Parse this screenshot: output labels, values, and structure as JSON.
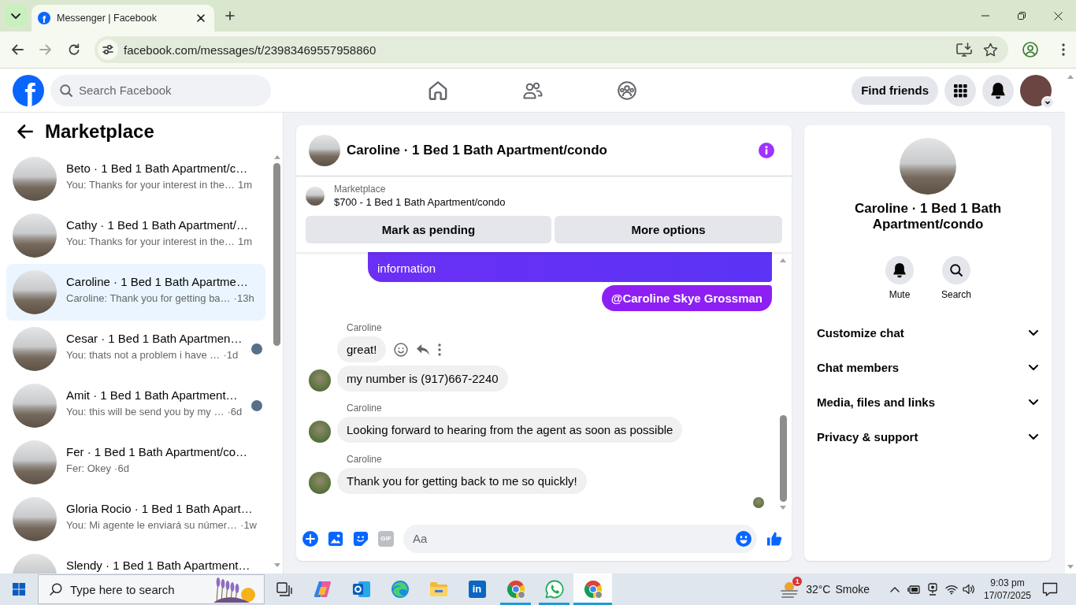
{
  "browser": {
    "tabs": [
      {
        "favicon": "f",
        "title": "Messenger | Facebook",
        "selected": true
      }
    ],
    "forward": {
      "disabled": true
    },
    "url": "facebook.com/messages/t/23983469557958860"
  },
  "header": {
    "logo": "f",
    "search": {
      "placeholder": "Search Facebook"
    },
    "find_friends": "Find friends"
  },
  "sidebar": {
    "title": "Marketplace",
    "conversations": [
      {
        "title": "Beto · 1 Bed 1 Bath Apartment/c…",
        "preview": "You: Thanks for your interest in the…",
        "time": "1m",
        "selected": false,
        "seen": false
      },
      {
        "title": "Cathy · 1 Bed 1 Bath Apartment/…",
        "preview": "You: Thanks for your interest in the…",
        "time": "1m",
        "selected": false,
        "seen": false
      },
      {
        "title": "Caroline · 1 Bed 1 Bath Apartme…",
        "preview": "Caroline: Thank you for getting ba…",
        "time": "·13h",
        "selected": true,
        "seen": false
      },
      {
        "title": "Cesar · 1 Bed 1 Bath Apartmen…",
        "preview": "You: thats not a problem i have …",
        "time": "·1d",
        "selected": false,
        "seen": true
      },
      {
        "title": "Amit · 1 Bed 1 Bath Apartment…",
        "preview": "You: this will be send you by my …",
        "time": "·6d",
        "selected": false,
        "seen": true
      },
      {
        "title": "Fer · 1 Bed 1 Bath Apartment/co…",
        "preview": "Fer: Okey",
        "time": "·6d",
        "selected": false,
        "seen": false
      },
      {
        "title": "Gloria Rocio · 1 Bed 1 Bath Apart…",
        "preview": "You: Mi agente le enviará su númer…",
        "time": "·1w",
        "selected": false,
        "seen": false
      },
      {
        "title": "Slendy · 1 Bed 1 Bath Apartment…",
        "selected": false,
        "seen": false
      }
    ]
  },
  "chat": {
    "title": "Caroline · 1 Bed 1 Bath Apartment/condo",
    "listing": {
      "source": "Marketplace",
      "title": "$700 - 1 Bed 1 Bath Apartment/condo"
    },
    "actions": [
      "Mark as pending",
      "More options"
    ],
    "messages": [
      {
        "kind": "outgoing",
        "text": "information",
        "clipped": true
      },
      {
        "kind": "mention",
        "text": "@Caroline Skye Grossman",
        "clipped": false
      },
      {
        "kind": "incoming",
        "sender": "Caroline",
        "text": "great!",
        "clipped": false,
        "avatar": false,
        "hovered": true
      },
      {
        "kind": "incoming",
        "text": "my number is (917)667-2240",
        "clipped": false,
        "avatar": true,
        "hovered": false
      },
      {
        "kind": "incoming",
        "sender": "Caroline",
        "text": "Looking forward to hearing from the agent as soon as possible",
        "clipped": false,
        "avatar": true,
        "hovered": false
      },
      {
        "kind": "incoming",
        "sender": "Caroline",
        "text": "Thank you for getting back to me so quickly!",
        "clipped": false,
        "avatar": true,
        "hovered": false
      }
    ],
    "read_receipt": true,
    "composer": {
      "gif": "GIF",
      "placeholder": "Aa"
    }
  },
  "details": {
    "name": "Caroline · 1 Bed 1 Bath Apartment/condo",
    "buttons": [
      {
        "kind": "mute",
        "label": "Mute"
      },
      {
        "kind": "search",
        "label": "Search"
      }
    ],
    "sections": [
      {
        "label": "Customize chat",
        "expanded": false
      },
      {
        "label": "Chat members",
        "expanded": false
      },
      {
        "label": "Media, files and links",
        "expanded": false
      },
      {
        "label": "Privacy & support",
        "expanded": false
      }
    ]
  },
  "taskbar": {
    "search": {
      "placeholder": "Type here to search"
    },
    "apps": [
      {
        "kind": "task-view",
        "running": false,
        "active": false
      },
      {
        "kind": "copilot",
        "running": false,
        "active": false
      },
      {
        "kind": "outlook",
        "running": false,
        "active": false
      },
      {
        "kind": "edge",
        "running": false,
        "active": false
      },
      {
        "kind": "folder",
        "running": false,
        "active": false
      },
      {
        "kind": "linkedin",
        "label": "in",
        "running": false,
        "active": false
      },
      {
        "kind": "chrome",
        "running": true,
        "active": false
      },
      {
        "kind": "whatsapp",
        "running": true,
        "active": false
      },
      {
        "kind": "chrome",
        "running": true,
        "active": true
      }
    ],
    "weather": {
      "badge": "1",
      "temperature": "32°C",
      "condition": "Smoke"
    },
    "clock": {
      "time": "9:03 pm",
      "date": "17/07/2025"
    }
  }
}
